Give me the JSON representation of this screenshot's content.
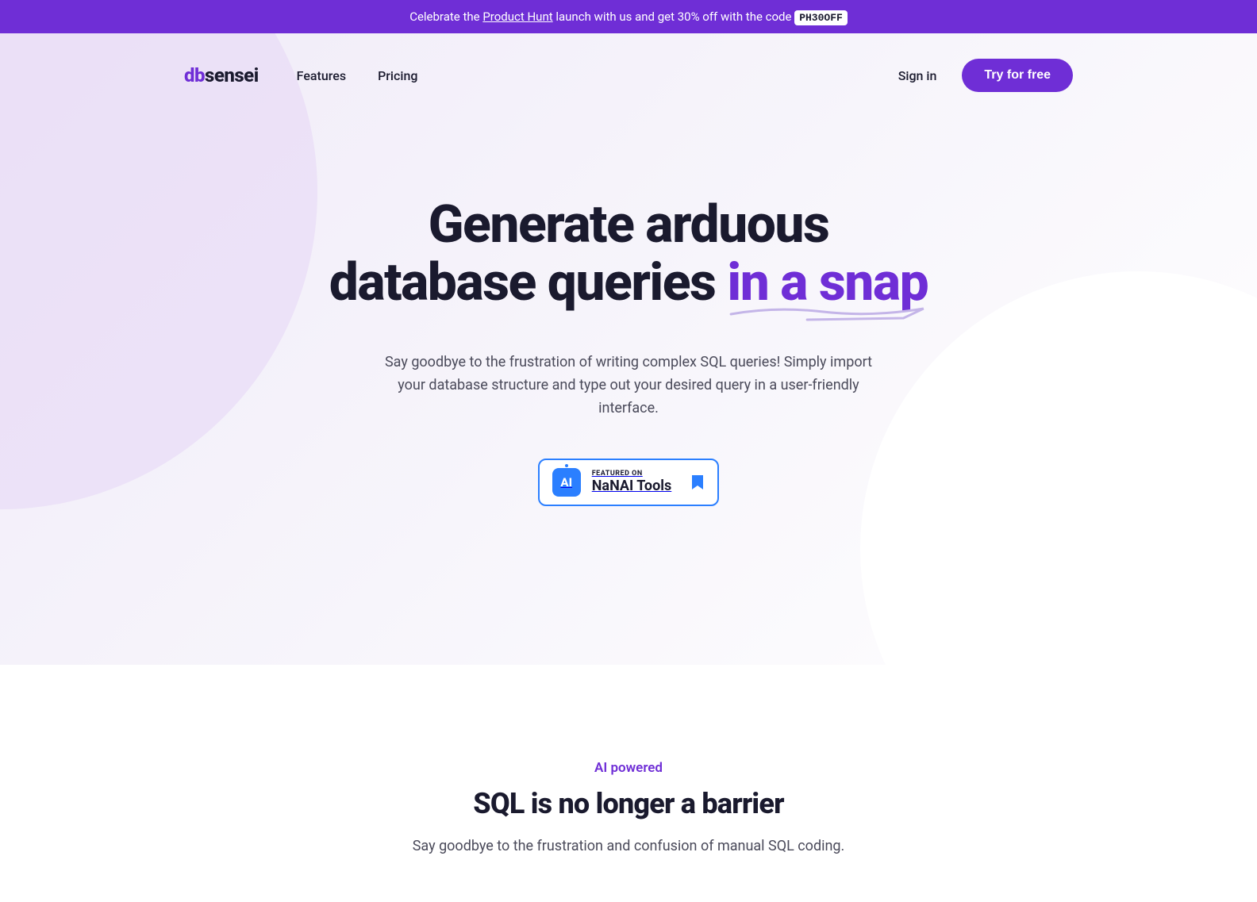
{
  "banner": {
    "prefix": "Celebrate the ",
    "link": "Product Hunt",
    "suffix": " launch with us and get 30% off with the code ",
    "code": "PH30OFF"
  },
  "nav": {
    "logo_prefix": "db",
    "logo_suffix": "sensei",
    "links": {
      "features": "Features",
      "pricing": "Pricing"
    },
    "sign_in": "Sign in",
    "try_free": "Try for free"
  },
  "hero": {
    "title_line1": "Generate arduous",
    "title_line2_prefix": "database queries",
    "title_line2_highlight": "in a snap",
    "subtitle": "Say goodbye to the frustration of writing complex SQL queries! Simply import your database structure and type out your desired query in a user-friendly interface."
  },
  "featured": {
    "label": "FEATURED ON",
    "name": "NaNAI Tools",
    "icon_text": "AI"
  },
  "section2": {
    "label": "AI powered",
    "title": "SQL is no longer a barrier",
    "subtitle": "Say goodbye to the frustration and confusion of manual SQL coding."
  }
}
